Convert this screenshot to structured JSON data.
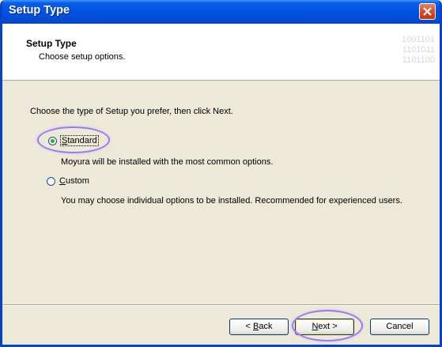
{
  "window": {
    "title": "Setup Type"
  },
  "header": {
    "title": "Setup Type",
    "subtitle": "Choose setup options.",
    "icon_name": "binary-digits-icon",
    "icon_lines": [
      "1001101",
      "1101011",
      "1101100"
    ]
  },
  "body": {
    "prompt": "Choose the type of Setup you prefer, then click Next.",
    "options": [
      {
        "label_mnemonic": "S",
        "label_rest": "tandard",
        "selected": true,
        "description": "Moyura will be installed with the most common options."
      },
      {
        "label_mnemonic": "C",
        "label_rest": "ustom",
        "selected": false,
        "description": "You may choose individual options to be installed. Recommended for experienced users."
      }
    ]
  },
  "footer": {
    "back": {
      "prefix": "< ",
      "mnemonic": "B",
      "rest": "ack"
    },
    "next": {
      "mnemonic": "N",
      "rest": "ext >"
    },
    "cancel": "Cancel"
  },
  "colors": {
    "titlebar": "#0053e4",
    "highlight": "#9a7af0",
    "radio_dot": "#2db128"
  }
}
